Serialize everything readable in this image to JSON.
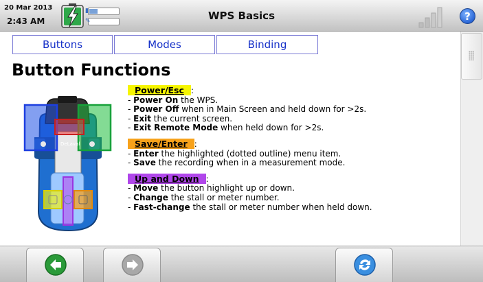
{
  "status": {
    "date": "20 Mar 2013",
    "time": "2:43 AM"
  },
  "header": {
    "title": "WPS Basics"
  },
  "tabs": [
    {
      "label": "Buttons"
    },
    {
      "label": "Modes"
    },
    {
      "label": "Binding"
    }
  ],
  "main": {
    "heading": "Button Functions",
    "device_label": "DeLaval",
    "sections": [
      {
        "label": "Power/Esc",
        "suffix": ":",
        "color": "#f6f500",
        "lines": [
          {
            "bold": "Power On",
            "text": " the WPS."
          },
          {
            "bold": "Power Off",
            "text": " when in Main Screen and held down for >2s."
          },
          {
            "bold": "Exit",
            "text": " the current screen."
          },
          {
            "bold": "Exit Remote Mode",
            "text": " when held down for >2s."
          }
        ]
      },
      {
        "label": "Save/Enter",
        "suffix": ":",
        "color": "#f7a21b",
        "lines": [
          {
            "bold": "Enter",
            "text": " the highlighted (dotted outline) menu item."
          },
          {
            "bold": "Save",
            "text": " the recording when in a measurement mode."
          }
        ]
      },
      {
        "label": "Up and Down",
        "suffix": ":",
        "color": "#b046ea",
        "lines": [
          {
            "bold": "Move",
            "text": " the button highlight up or down."
          },
          {
            "bold": "Change",
            "text": " the stall or meter number."
          },
          {
            "bold": "Fast-change",
            "text": " the stall or meter number when held down."
          }
        ]
      }
    ]
  },
  "bottom_bar": {
    "back": "back-arrow-icon",
    "forward": "forward-arrow-icon",
    "refresh": "refresh-icon"
  }
}
